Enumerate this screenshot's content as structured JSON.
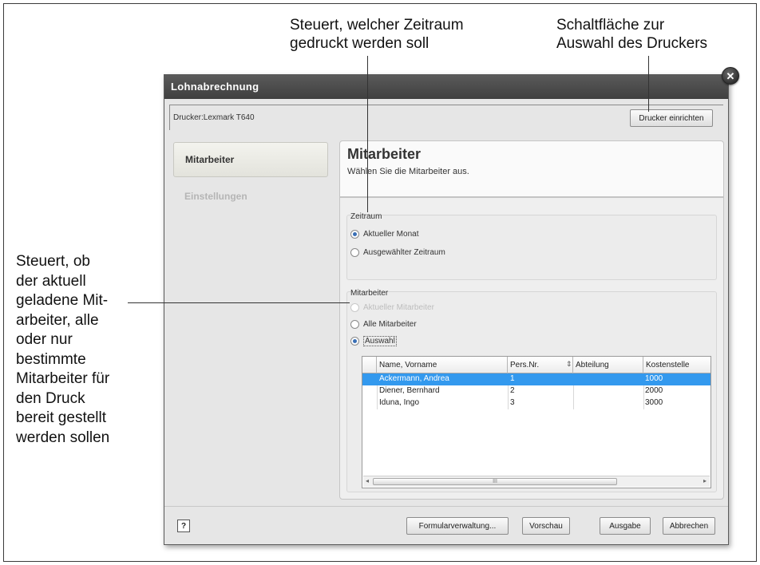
{
  "callouts": {
    "zeitraum": [
      "Steuert, welcher Zeitraum",
      "gedruckt werden soll"
    ],
    "drucker": [
      "Schaltfläche zur",
      "Auswahl des Druckers"
    ],
    "mitarbeiter": [
      "Steuert, ob",
      "der aktuell",
      "geladene Mit-",
      "arbeiter, alle",
      "oder nur",
      "bestimmte",
      "Mitarbeiter für",
      "den Druck",
      "bereit gestellt",
      "werden sollen"
    ]
  },
  "dialog": {
    "title": "Lohnabrechnung",
    "printer_label": "Drucker:Lexmark T640",
    "printer_button": "Drucker einrichten"
  },
  "nav": {
    "items": [
      "Mitarbeiter",
      "Einstellungen"
    ]
  },
  "content": {
    "title": "Mitarbeiter",
    "subtitle": "Wählen Sie die Mitarbeiter aus."
  },
  "zeitraum": {
    "label": "Zeitraum",
    "options": [
      "Aktueller Monat",
      "Ausgewählter Zeitraum"
    ]
  },
  "mitarbeiter_group": {
    "label": "Mitarbeiter",
    "options": [
      "Aktueller Mitarbeiter",
      "Alle Mitarbeiter",
      "Auswahl"
    ]
  },
  "table": {
    "columns": [
      "Name, Vorname",
      "Pers.Nr.",
      "Abteilung",
      "Kostenstelle"
    ],
    "rows": [
      [
        "Ackermann, Andrea",
        "1",
        "",
        "1000"
      ],
      [
        "Diener, Bernhard",
        "2",
        "",
        "2000"
      ],
      [
        "Iduna, Ingo",
        "3",
        "",
        "3000"
      ]
    ],
    "scrollbar_grip": "III",
    "scroll_left": "◂",
    "scroll_right": "▸"
  },
  "footer": {
    "help": "?",
    "buttons": [
      "Formularverwaltung...",
      "Vorschau",
      "Ausgabe",
      "Abbrechen"
    ]
  },
  "close_label": "✕"
}
